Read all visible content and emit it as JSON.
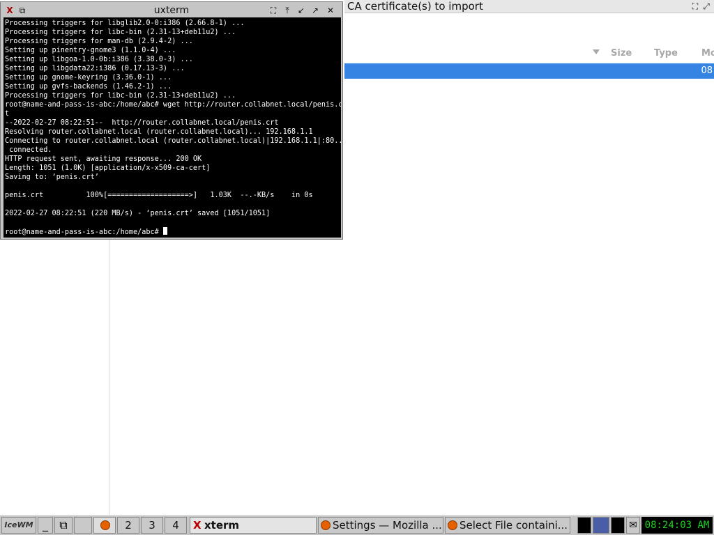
{
  "background_window": {
    "title": "CA certificate(s) to import",
    "columns": [
      "Size",
      "Type",
      "Mo"
    ],
    "selected_row_modified": "08"
  },
  "xterm": {
    "title": "uxterm",
    "lines": [
      "Processing triggers for libglib2.0-0:i386 (2.66.8-1) ...",
      "Processing triggers for libc-bin (2.31-13+deb11u2) ...",
      "Processing triggers for man-db (2.9.4-2) ...",
      "Setting up pinentry-gnome3 (1.1.0-4) ...",
      "Setting up libgoa-1.0-0b:i386 (3.38.0-3) ...",
      "Setting up libgdata22:i386 (0.17.13-3) ...",
      "Setting up gnome-keyring (3.36.0-1) ...",
      "Setting up gvfs-backends (1.46.2-1) ...",
      "Processing triggers for libc-bin (2.31-13+deb11u2) ...",
      "root@name-and-pass-is-abc:/home/abc# wget http://router.collabnet.local/penis.crt",
      "t",
      "--2022-02-27 08:22:51--  http://router.collabnet.local/penis.crt",
      "Resolving router.collabnet.local (router.collabnet.local)... 192.168.1.1",
      "Connecting to router.collabnet.local (router.collabnet.local)|192.168.1.1|:80...",
      " connected.",
      "HTTP request sent, awaiting response... 200 OK",
      "Length: 1051 (1.0K) [application/x-x509-ca-cert]",
      "Saving to: ‘penis.crt’",
      "",
      "penis.crt          100%[===================>]   1.03K  --.-KB/s    in 0s",
      "",
      "2022-02-27 08:22:51 (220 MB/s) - ‘penis.crt’ saved [1051/1051]",
      "",
      "root@name-and-pass-is-abc:/home/abc# "
    ]
  },
  "taskbar": {
    "logo": "IceWM",
    "workspaces": [
      "2",
      "3",
      "4"
    ],
    "tasks": [
      {
        "label": "xterm",
        "icon": "xterm-icon"
      },
      {
        "label": "Settings — Mozilla ...",
        "icon": "firefox-icon"
      },
      {
        "label": "Select File containi...",
        "icon": "firefox-icon"
      }
    ],
    "clock": "08:24:03 AM"
  }
}
